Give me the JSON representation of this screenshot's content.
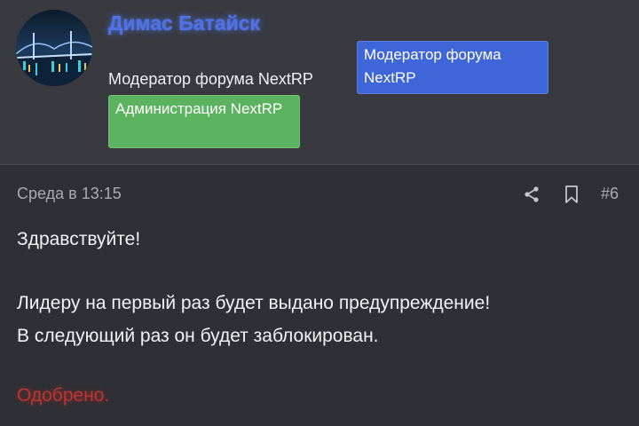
{
  "user": {
    "name": "Димас Батайск",
    "title": "Модератор форума NextRP",
    "badges": [
      {
        "label": "Модератор форума NextRP",
        "color": "#3f66d9"
      },
      {
        "label": "Администрация NextRP",
        "color": "#5cb35f"
      }
    ]
  },
  "post": {
    "date": "Среда в 13:15",
    "number": "#6",
    "icons": [
      "share-icon",
      "bookmark-icon"
    ],
    "lines": [
      "Здравствуйте!",
      "Лидеру на первый раз будет выдано предупреждение!",
      "В следующий раз он будет заблокирован."
    ],
    "status": "Одобрено.",
    "status_color": "#c0332f"
  }
}
